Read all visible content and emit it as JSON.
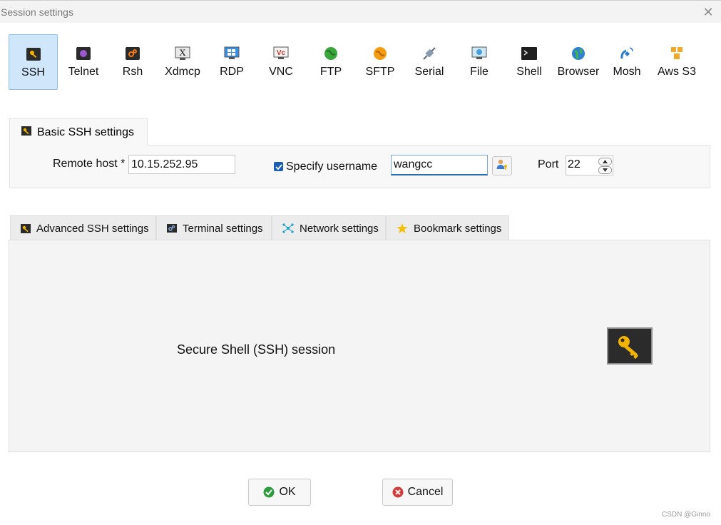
{
  "window": {
    "title": "Session settings"
  },
  "protocols": [
    {
      "label": "SSH",
      "icon": "ssh-key-icon",
      "selected": true
    },
    {
      "label": "Telnet",
      "icon": "telnet-icon"
    },
    {
      "label": "Rsh",
      "icon": "rsh-icon"
    },
    {
      "label": "Xdmcp",
      "icon": "xdmcp-icon"
    },
    {
      "label": "RDP",
      "icon": "rdp-icon"
    },
    {
      "label": "VNC",
      "icon": "vnc-icon"
    },
    {
      "label": "FTP",
      "icon": "ftp-globe-icon"
    },
    {
      "label": "SFTP",
      "icon": "sftp-icon"
    },
    {
      "label": "Serial",
      "icon": "serial-plug-icon"
    },
    {
      "label": "File",
      "icon": "file-icon"
    },
    {
      "label": "Shell",
      "icon": "shell-terminal-icon"
    },
    {
      "label": "Browser",
      "icon": "browser-globe-icon"
    },
    {
      "label": "Mosh",
      "icon": "mosh-satellite-icon"
    },
    {
      "label": "Aws S3",
      "icon": "aws-s3-icon"
    }
  ],
  "basic": {
    "tab_label": "Basic SSH settings",
    "remote_host_label": "Remote host *",
    "remote_host_value": "10.15.252.95",
    "specify_username_label": "Specify username",
    "specify_username_checked": true,
    "username_value": "wangcc",
    "port_label": "Port",
    "port_value": "22"
  },
  "tabs": [
    {
      "label": "Advanced SSH settings",
      "icon": "wrench-key-icon"
    },
    {
      "label": "Terminal settings",
      "icon": "terminal-icon"
    },
    {
      "label": "Network settings",
      "icon": "network-icon"
    },
    {
      "label": "Bookmark settings",
      "icon": "star-icon"
    }
  ],
  "description": "Secure Shell (SSH) session",
  "buttons": {
    "ok": "OK",
    "cancel": "Cancel"
  },
  "watermark": "CSDN @Ginno",
  "colors": {
    "selected_bg": "#cfe6fb",
    "ok_green": "#2e9b3f",
    "cancel_red": "#d63b3b",
    "checkbox_blue": "#1a5fb4"
  }
}
